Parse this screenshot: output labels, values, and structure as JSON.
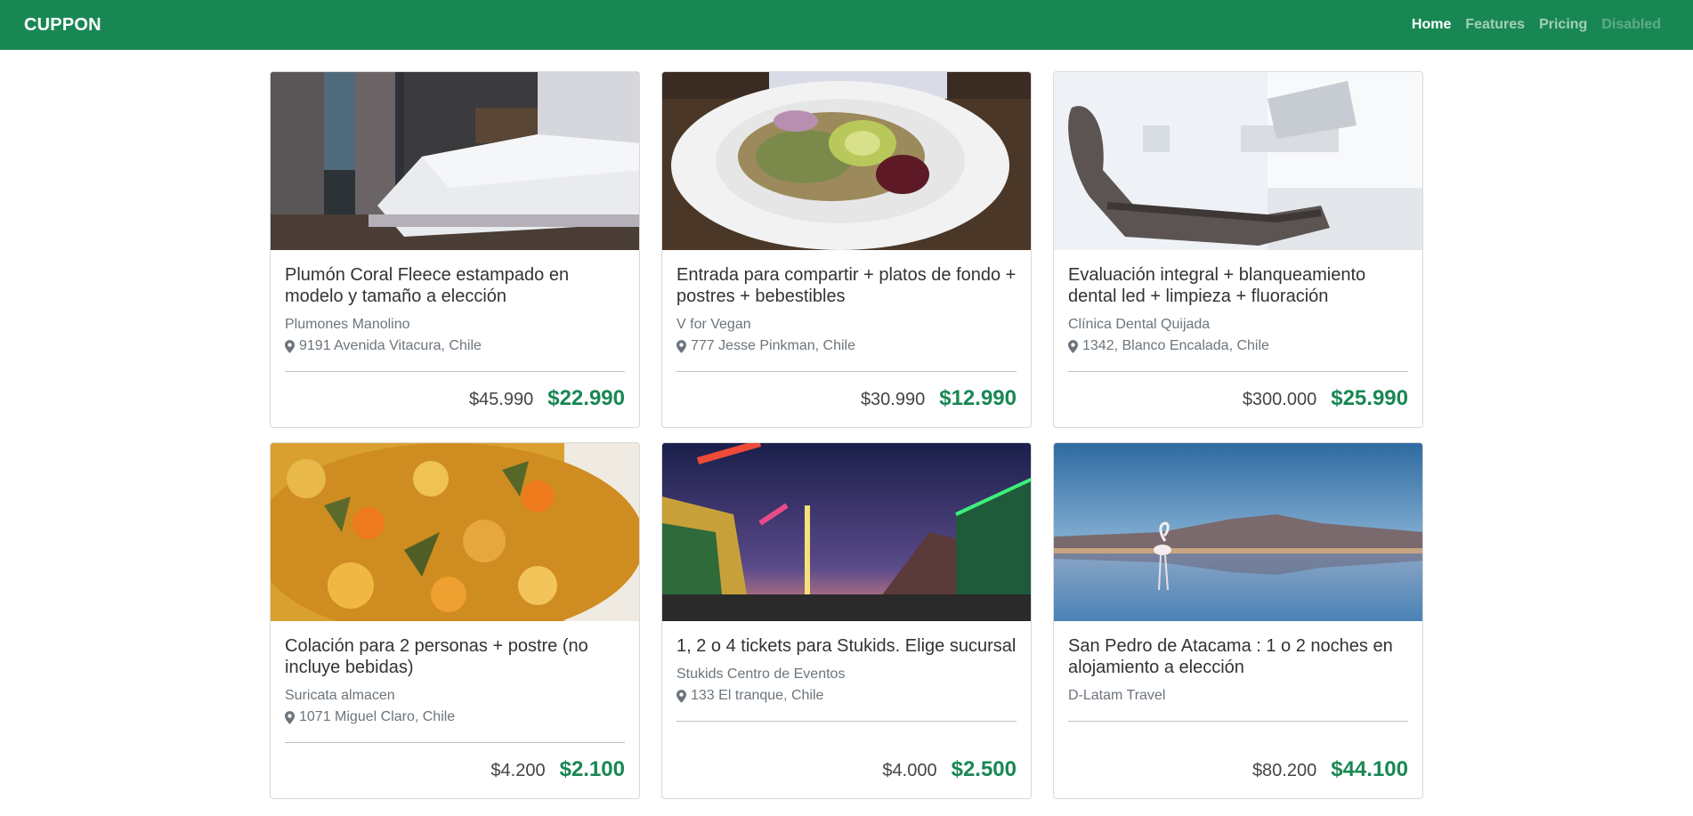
{
  "navbar": {
    "brand": "CUPPON",
    "links": [
      {
        "label": "Home",
        "state": "active"
      },
      {
        "label": "Features",
        "state": "normal"
      },
      {
        "label": "Pricing",
        "state": "normal"
      },
      {
        "label": "Disabled",
        "state": "disabled"
      }
    ]
  },
  "colors": {
    "brand": "#198754",
    "price_new": "#198754"
  },
  "icons": {
    "location": "map-marker-icon"
  },
  "cards": [
    {
      "image": "bedroom-bed-photo",
      "title": "Plumón Coral Fleece estampado en modelo y tamaño a elección",
      "merchant": "Plumones Manolino",
      "location": "9191 Avenida Vitacura, Chile",
      "old_price": "$45.990",
      "new_price": "$22.990"
    },
    {
      "image": "vegan-salad-plate-photo",
      "title": "Entrada para compartir + platos de fondo + postres + bebestibles",
      "merchant": "V for Vegan",
      "location": "777 Jesse Pinkman, Chile",
      "old_price": "$30.990",
      "new_price": "$12.990"
    },
    {
      "image": "dental-chair-photo",
      "title": "Evaluación integral + blanqueamiento dental led + limpieza + fluoración",
      "merchant": "Clínica Dental Quijada",
      "location": "1342, Blanco Encalada, Chile",
      "old_price": "$300.000",
      "new_price": "$25.990"
    },
    {
      "image": "vegetable-stew-photo",
      "title": "Colación para 2 personas + postre (no incluye bebidas)",
      "merchant": "Suricata almacen",
      "location": "1071 Miguel Claro, Chile",
      "old_price": "$4.200",
      "new_price": "$2.100"
    },
    {
      "image": "amusement-park-night-photo",
      "title": "1, 2 o 4 tickets para Stukids. Elige sucursal",
      "merchant": "Stukids Centro de Eventos",
      "location": "133 El tranque, Chile",
      "old_price": "$4.000",
      "new_price": "$2.500"
    },
    {
      "image": "atacama-flamingo-lake-photo",
      "title": "San Pedro de Atacama : 1 o 2 noches en alojamiento a elección",
      "merchant": "D-Latam Travel",
      "location": "",
      "old_price": "$80.200",
      "new_price": "$44.100"
    }
  ]
}
